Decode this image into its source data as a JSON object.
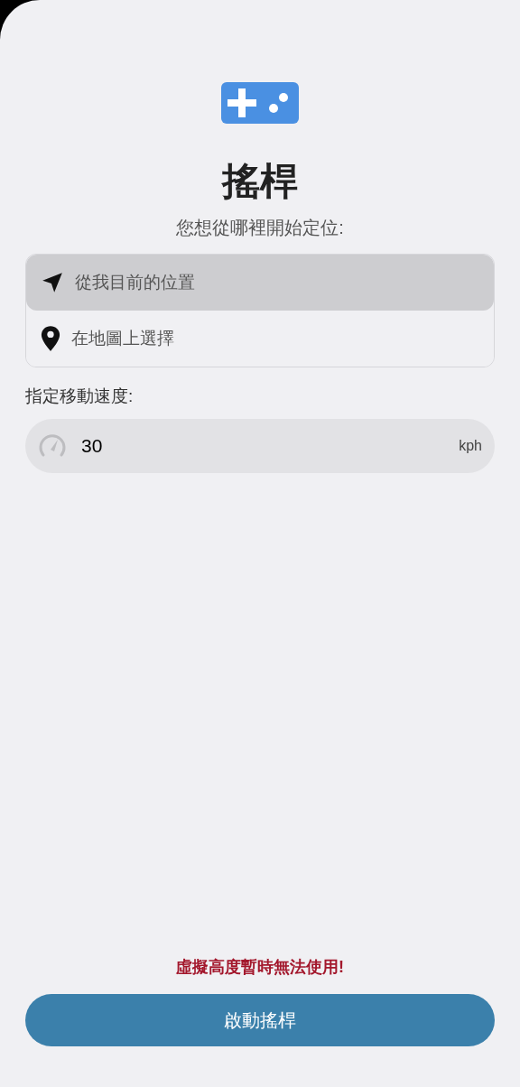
{
  "title": "搖桿",
  "prompt": "您想從哪裡開始定位:",
  "options": [
    {
      "kind": "current",
      "label": "從我目前的位置",
      "selected": true
    },
    {
      "kind": "map",
      "label": "在地圖上選擇",
      "selected": false
    }
  ],
  "speed": {
    "label": "指定移動速度:",
    "value": "30",
    "unit": "kph"
  },
  "warning": "虛擬高度暫時無法使用!",
  "start_button": "啟動搖桿"
}
